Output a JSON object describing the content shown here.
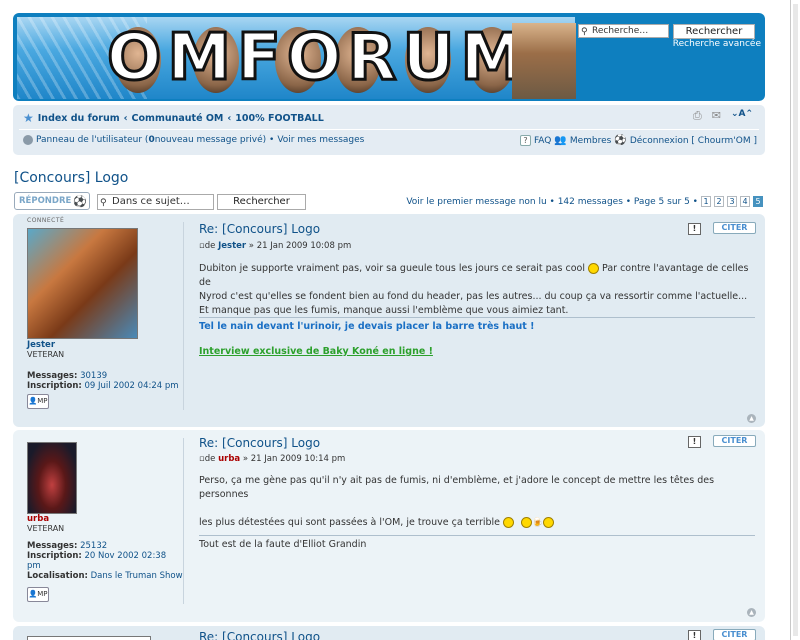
{
  "header": {
    "logo_text": "OMFORUM",
    "search_placeholder": "Recherche…",
    "search_button": "Rechercher",
    "advanced_search": "Recherche avancée"
  },
  "nav": {
    "breadcrumb": [
      "Index du forum",
      "Communauté OM",
      "100% FOOTBALL"
    ],
    "breadcrumb_sep": "‹",
    "user_panel": "Panneau de l'utilisateur (",
    "new_pm_count": "0",
    "new_pm_text": " nouveau message privé) • ",
    "view_messages": "Voir mes messages",
    "faq": "FAQ",
    "members": "Membres",
    "logout": "Déconnexion [ Chourm'OM ]"
  },
  "topic": {
    "title": "[Concours] Logo",
    "reply_button": "RÉPONDRE",
    "search_placeholder": "Dans ce sujet…",
    "search_button": "Rechercher",
    "pagination_text": "Voir le premier message non lu • 142 messages • Page 5 sur 5 •",
    "pages": [
      "1",
      "2",
      "3",
      "4",
      "5"
    ],
    "current_page": "5"
  },
  "posts": [
    {
      "online_label": "CONNECTÉ",
      "username": "Jester",
      "rank": "VETERAN",
      "messages_label": "Messages:",
      "messages": "30139",
      "inscription_label": "Inscription:",
      "inscription": "09 Juil 2002 04:24 pm",
      "pm_label": "MP",
      "title": "Re: [Concours] Logo",
      "author_prefix": "de ",
      "date": " » 21 Jan 2009 10:08 pm",
      "body_lines": [
        "Dubiton je supporte vraiment pas, voir sa gueule tous les jours ce serait pas cool",
        " Par contre l'avantage de celles de",
        "Nyrod c'est qu'elles se fondent bien au fond du header, pas les autres... du coup ça va ressortir comme l'actuelle...",
        "Et manque pas que les fumis, manque aussi l'emblème que vous aimiez tant."
      ],
      "sig1": "Tel le nain devant l'urinoir, je devais placer la barre très haut !",
      "sig2": "Interview exclusive de Baky Koné en ligne !",
      "report": "!",
      "quote": "CITER"
    },
    {
      "username": "urba",
      "rank": "VETERAN",
      "messages_label": "Messages:",
      "messages": "25132",
      "inscription_label": "Inscription:",
      "inscription": "20 Nov 2002 02:38 pm",
      "localisation_label": "Localisation:",
      "localisation": "Dans le Truman Show",
      "pm_label": "MP",
      "title": "Re: [Concours] Logo",
      "author_prefix": "de ",
      "date": " » 21 Jan 2009 10:14 pm",
      "body_line1": "Perso, ça me gène pas qu'il n'y ait pas de fumis, ni d'emblème, et j'adore le concept de mettre les têtes des personnes",
      "body_line2": "les plus détestées qui sont passées à l'OM, je trouve ça terrible",
      "sig": "Tout est de la faute d'Elliot Grandin",
      "report": "!",
      "quote": "CITER"
    },
    {
      "title": "Re: [Concours] Logo",
      "report": "!",
      "quote": "CITER"
    }
  ],
  "colors": {
    "header_blue": "#0e7fbf",
    "link_blue": "#105289",
    "post_bg": "#e1ebf2",
    "post_bg_alt": "#ecf3f7",
    "sig_blue": "#1a6fc4",
    "sig_green": "#2ca02c",
    "admin_red": "#aa0000"
  }
}
